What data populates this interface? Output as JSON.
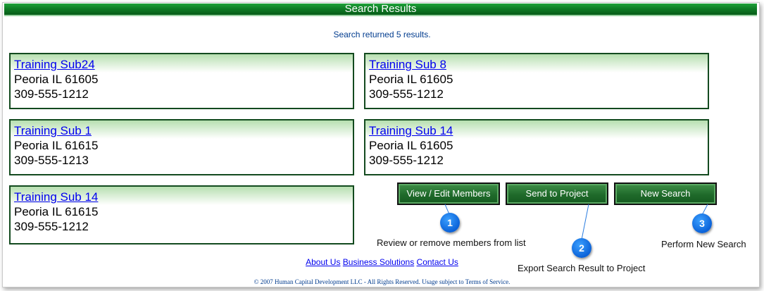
{
  "header": {
    "title": "Search Results"
  },
  "results": {
    "summary": "Search returned 5 results.",
    "items": [
      {
        "name": "Training Sub24",
        "city": "Peoria IL 61605",
        "phone": "309-555-1212"
      },
      {
        "name": "Training Sub 8",
        "city": "Peoria IL 61605",
        "phone": "309-555-1212"
      },
      {
        "name": "Training Sub 1",
        "city": "Peoria IL 61615",
        "phone": "309-555-1213"
      },
      {
        "name": "Training Sub 14",
        "city": "Peoria IL 61605",
        "phone": "309-555-1212"
      },
      {
        "name": "Training Sub 14",
        "city": "Peoria IL 61615",
        "phone": "309-555-1212"
      }
    ]
  },
  "actions": {
    "view_edit": "View / Edit Members",
    "send_project": "Send to Project",
    "new_search": "New Search"
  },
  "callouts": [
    {
      "number": "1",
      "text": "Review or remove members from list"
    },
    {
      "number": "2",
      "text": "Export Search Result to Project"
    },
    {
      "number": "3",
      "text": "Perform New Search"
    }
  ],
  "footer": {
    "about": "About Us",
    "business": "Business Solutions",
    "contact": "Contact Us",
    "copyright": "© 2007 Human Capital Development LLC - All Rights Reserved. Usage subject to Terms of Service."
  },
  "colors": {
    "accent_green": "#1f6a2a",
    "callout_blue": "#0b62d8",
    "link": "#0000ee"
  }
}
